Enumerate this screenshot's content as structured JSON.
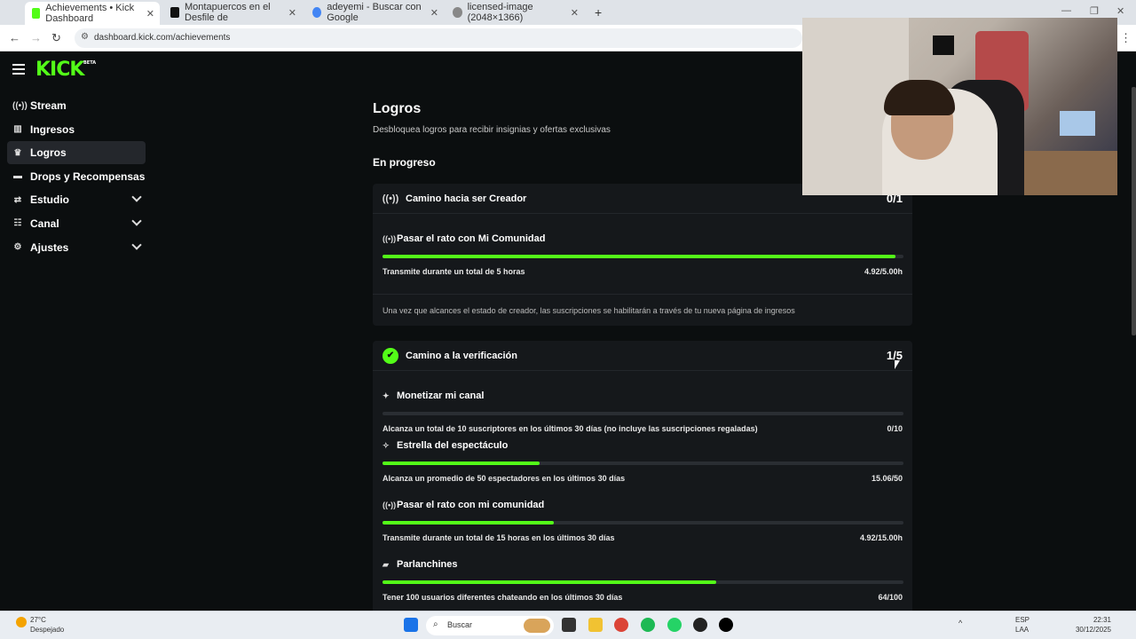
{
  "browser": {
    "tabs": [
      {
        "title": "Achievements • Kick Dashboard",
        "color": "#53fc18"
      },
      {
        "title": "Montapuercos en el Desfile de",
        "color": "#111111"
      },
      {
        "title": "adeyemi - Buscar con Google",
        "color": "#4285f4"
      },
      {
        "title": "licensed-image (2048×1366)",
        "color": "#888888"
      }
    ],
    "url": "dashboard.kick.com/achievements"
  },
  "app": {
    "logo": "KICK",
    "logo_tag": "BETA",
    "sidebar": [
      {
        "label": "Stream",
        "icon": "broadcast-icon",
        "glyph": "((•))",
        "active": false,
        "expandable": false
      },
      {
        "label": "Ingresos",
        "icon": "chart-icon",
        "glyph": "▥",
        "active": false,
        "expandable": false
      },
      {
        "label": "Logros",
        "icon": "trophy-icon",
        "glyph": "🏆",
        "active": true,
        "expandable": false
      },
      {
        "label": "Drops y Recompensas",
        "icon": "gift-icon",
        "glyph": "▬",
        "active": false,
        "expandable": false
      },
      {
        "label": "Estudio",
        "icon": "studio-icon",
        "glyph": "⚙",
        "active": false,
        "expandable": true
      },
      {
        "label": "Canal",
        "icon": "users-icon",
        "glyph": "👥",
        "active": false,
        "expandable": true
      },
      {
        "label": "Ajustes",
        "icon": "settings-icon",
        "glyph": "⚙",
        "active": false,
        "expandable": true
      }
    ],
    "page_title": "Logros",
    "page_subtitle": "Desbloquea logros para recibir insignias y ofertas exclusivas",
    "section_title": "En progreso",
    "cards": [
      {
        "title": "Camino hacia ser Creador",
        "count": "0/1",
        "icon": "broadcast-icon",
        "tasks": [
          {
            "title": "Pasar el rato con Mi Comunidad",
            "icon": "broadcast-icon",
            "desc": "Transmite durante un total de 5 horas",
            "value": "4.92/5.00h",
            "progress": 0.984
          }
        ],
        "note": "Una vez que alcances el estado de creador, las suscripciones se habilitarán a través de tu nueva página de ingresos"
      },
      {
        "title": "Camino a la verificación",
        "count": "1/5",
        "icon": "verified-badge-icon",
        "tasks": [
          {
            "title": "Monetizar mi canal",
            "icon": "sparkle-icon",
            "desc": "Alcanza un total de 10 suscriptores en los últimos 30 días (no incluye las suscripciones regaladas)",
            "value": "0/10",
            "progress": 0.0
          },
          {
            "title": "Estrella del espectáculo",
            "icon": "star-icon",
            "desc": "Alcanza un promedio de 50 espectadores en los últimos 30 días",
            "value": "15.06/50",
            "progress": 0.301
          },
          {
            "title": "Pasar el rato con mi comunidad",
            "icon": "broadcast-icon",
            "desc": "Transmite durante un total de 15 horas en los últimos 30 días",
            "value": "4.92/15.00h",
            "progress": 0.328
          },
          {
            "title": "Parlanchines",
            "icon": "chat-icon",
            "desc": "Tener 100 usuarios diferentes chateando en los últimos 30 días",
            "value": "64/100",
            "progress": 0.64
          }
        ]
      }
    ]
  },
  "taskbar": {
    "weather_temp": "27°C",
    "weather_desc": "Despejado",
    "search_placeholder": "Buscar",
    "lang_1": "ESP",
    "lang_2": "LAA",
    "time": "22:31",
    "date": "30/12/2025"
  }
}
